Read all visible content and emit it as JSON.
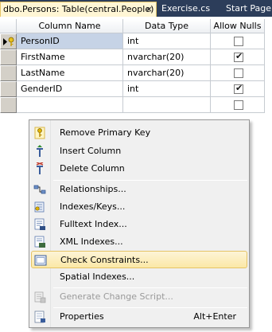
{
  "tabs": [
    {
      "label": "dbo.Persons: Table(central.People)",
      "close": "×",
      "active": true
    },
    {
      "label": "Exercise.cs",
      "active": false
    },
    {
      "label": "Start Page",
      "active": false
    }
  ],
  "grid": {
    "headers": {
      "column_name": "Column Name",
      "data_type": "Data Type",
      "allow_nulls": "Allow Nulls"
    },
    "rows": [
      {
        "name": "PersonID",
        "type": "int",
        "allow_nulls": false,
        "primary_key": true,
        "selected": true
      },
      {
        "name": "FirstName",
        "type": "nvarchar(20)",
        "allow_nulls": true
      },
      {
        "name": "LastName",
        "type": "nvarchar(20)",
        "allow_nulls": false
      },
      {
        "name": "GenderID",
        "type": "int",
        "allow_nulls": true
      },
      {
        "name": "",
        "type": "",
        "allow_nulls": false
      }
    ],
    "check_glyph": "✔"
  },
  "context_menu": {
    "items": [
      {
        "label": "Remove Primary Key",
        "icon": "key-icon"
      },
      {
        "label": "Insert Column",
        "icon": "insert-column-icon"
      },
      {
        "label": "Delete Column",
        "icon": "delete-column-icon"
      },
      {
        "label": "Relationships...",
        "icon": "relationships-icon"
      },
      {
        "label": "Indexes/Keys...",
        "icon": "indexes-keys-icon"
      },
      {
        "label": "Fulltext Index...",
        "icon": "fulltext-index-icon"
      },
      {
        "label": "XML Indexes...",
        "icon": "xml-indexes-icon"
      },
      {
        "label": "Check Constraints...",
        "icon": "check-constraints-icon",
        "highlighted": true
      },
      {
        "label": "Spatial Indexes...",
        "icon": ""
      },
      {
        "label": "Generate Change Script...",
        "icon": "generate-script-icon",
        "disabled": true
      },
      {
        "label": "Properties",
        "shortcut": "Alt+Enter",
        "icon": "properties-icon"
      }
    ]
  },
  "colors": {
    "tabbar_bg": "#2c3d5a",
    "active_tab_bg": "#fff6d5",
    "menu_highlight": "#fbe8a6",
    "selected_cell": "#c6d3e6"
  }
}
